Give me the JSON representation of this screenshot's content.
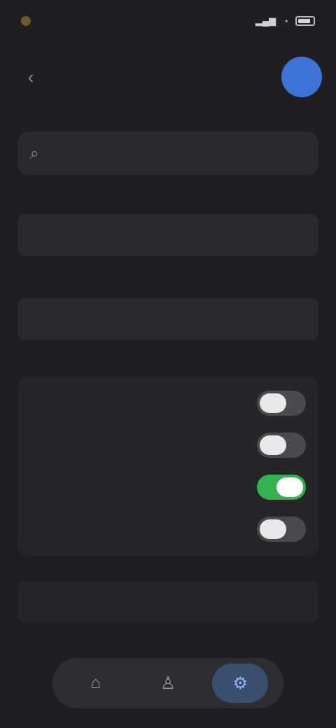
{
  "status": {
    "time": "",
    "signal": ""
  },
  "header": {
    "title": "",
    "avatar_initial": ""
  },
  "search": {
    "placeholder": "",
    "value": ""
  },
  "sections": {
    "first_label": "",
    "first_value": "",
    "second_label": "",
    "second_value": "",
    "third_label": ""
  },
  "toggles": [
    {
      "label": "",
      "state": "off"
    },
    {
      "label": "",
      "state": "off"
    },
    {
      "label": "",
      "state": "on"
    },
    {
      "label": "",
      "state": "off"
    }
  ],
  "link": {
    "label": ""
  },
  "tabs": [
    {
      "icon": "home-icon"
    },
    {
      "icon": "person-icon"
    },
    {
      "icon": "settings-icon",
      "active": true
    }
  ],
  "colors": {
    "accent": "#3d73d6",
    "toggle_on": "#34b24f",
    "background": "#1f1f21",
    "card": "#2a2a2d"
  }
}
